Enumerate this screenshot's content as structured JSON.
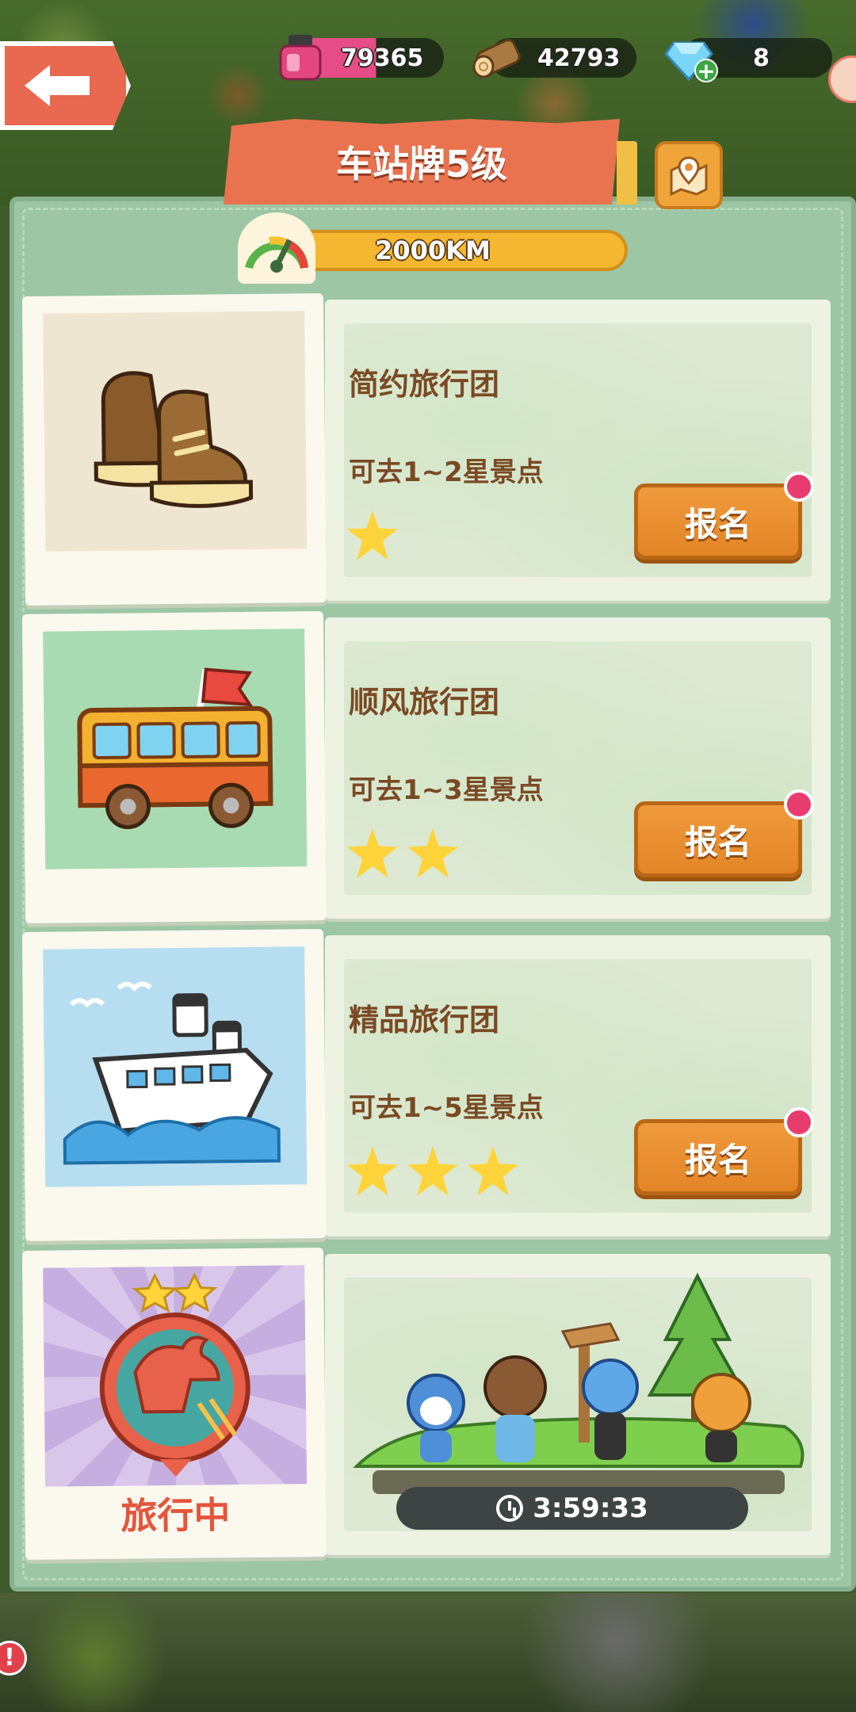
{
  "resources": {
    "ink": "79365",
    "wood": "42793",
    "gems": "8"
  },
  "header": {
    "title": "车站牌5级",
    "distance": "2000KM"
  },
  "groups": [
    {
      "name": "简约旅行团",
      "desc": "可去1~2星景点",
      "stars": 1,
      "button": "报名",
      "icon": "boots-icon"
    },
    {
      "name": "顺风旅行团",
      "desc": "可去1~3星景点",
      "stars": 2,
      "button": "报名",
      "icon": "bus-icon"
    },
    {
      "name": "精品旅行团",
      "desc": "可去1~5星景点",
      "stars": 3,
      "button": "报名",
      "icon": "ship-icon"
    }
  ],
  "active_trip": {
    "status": "旅行中",
    "timer": "3:59:33",
    "badge_stars": 2
  },
  "alert_badge": "!",
  "colors": {
    "accent": "#e9734f",
    "button": "#e38526",
    "panel": "#9cc6a4",
    "star": "#ffd43b"
  }
}
